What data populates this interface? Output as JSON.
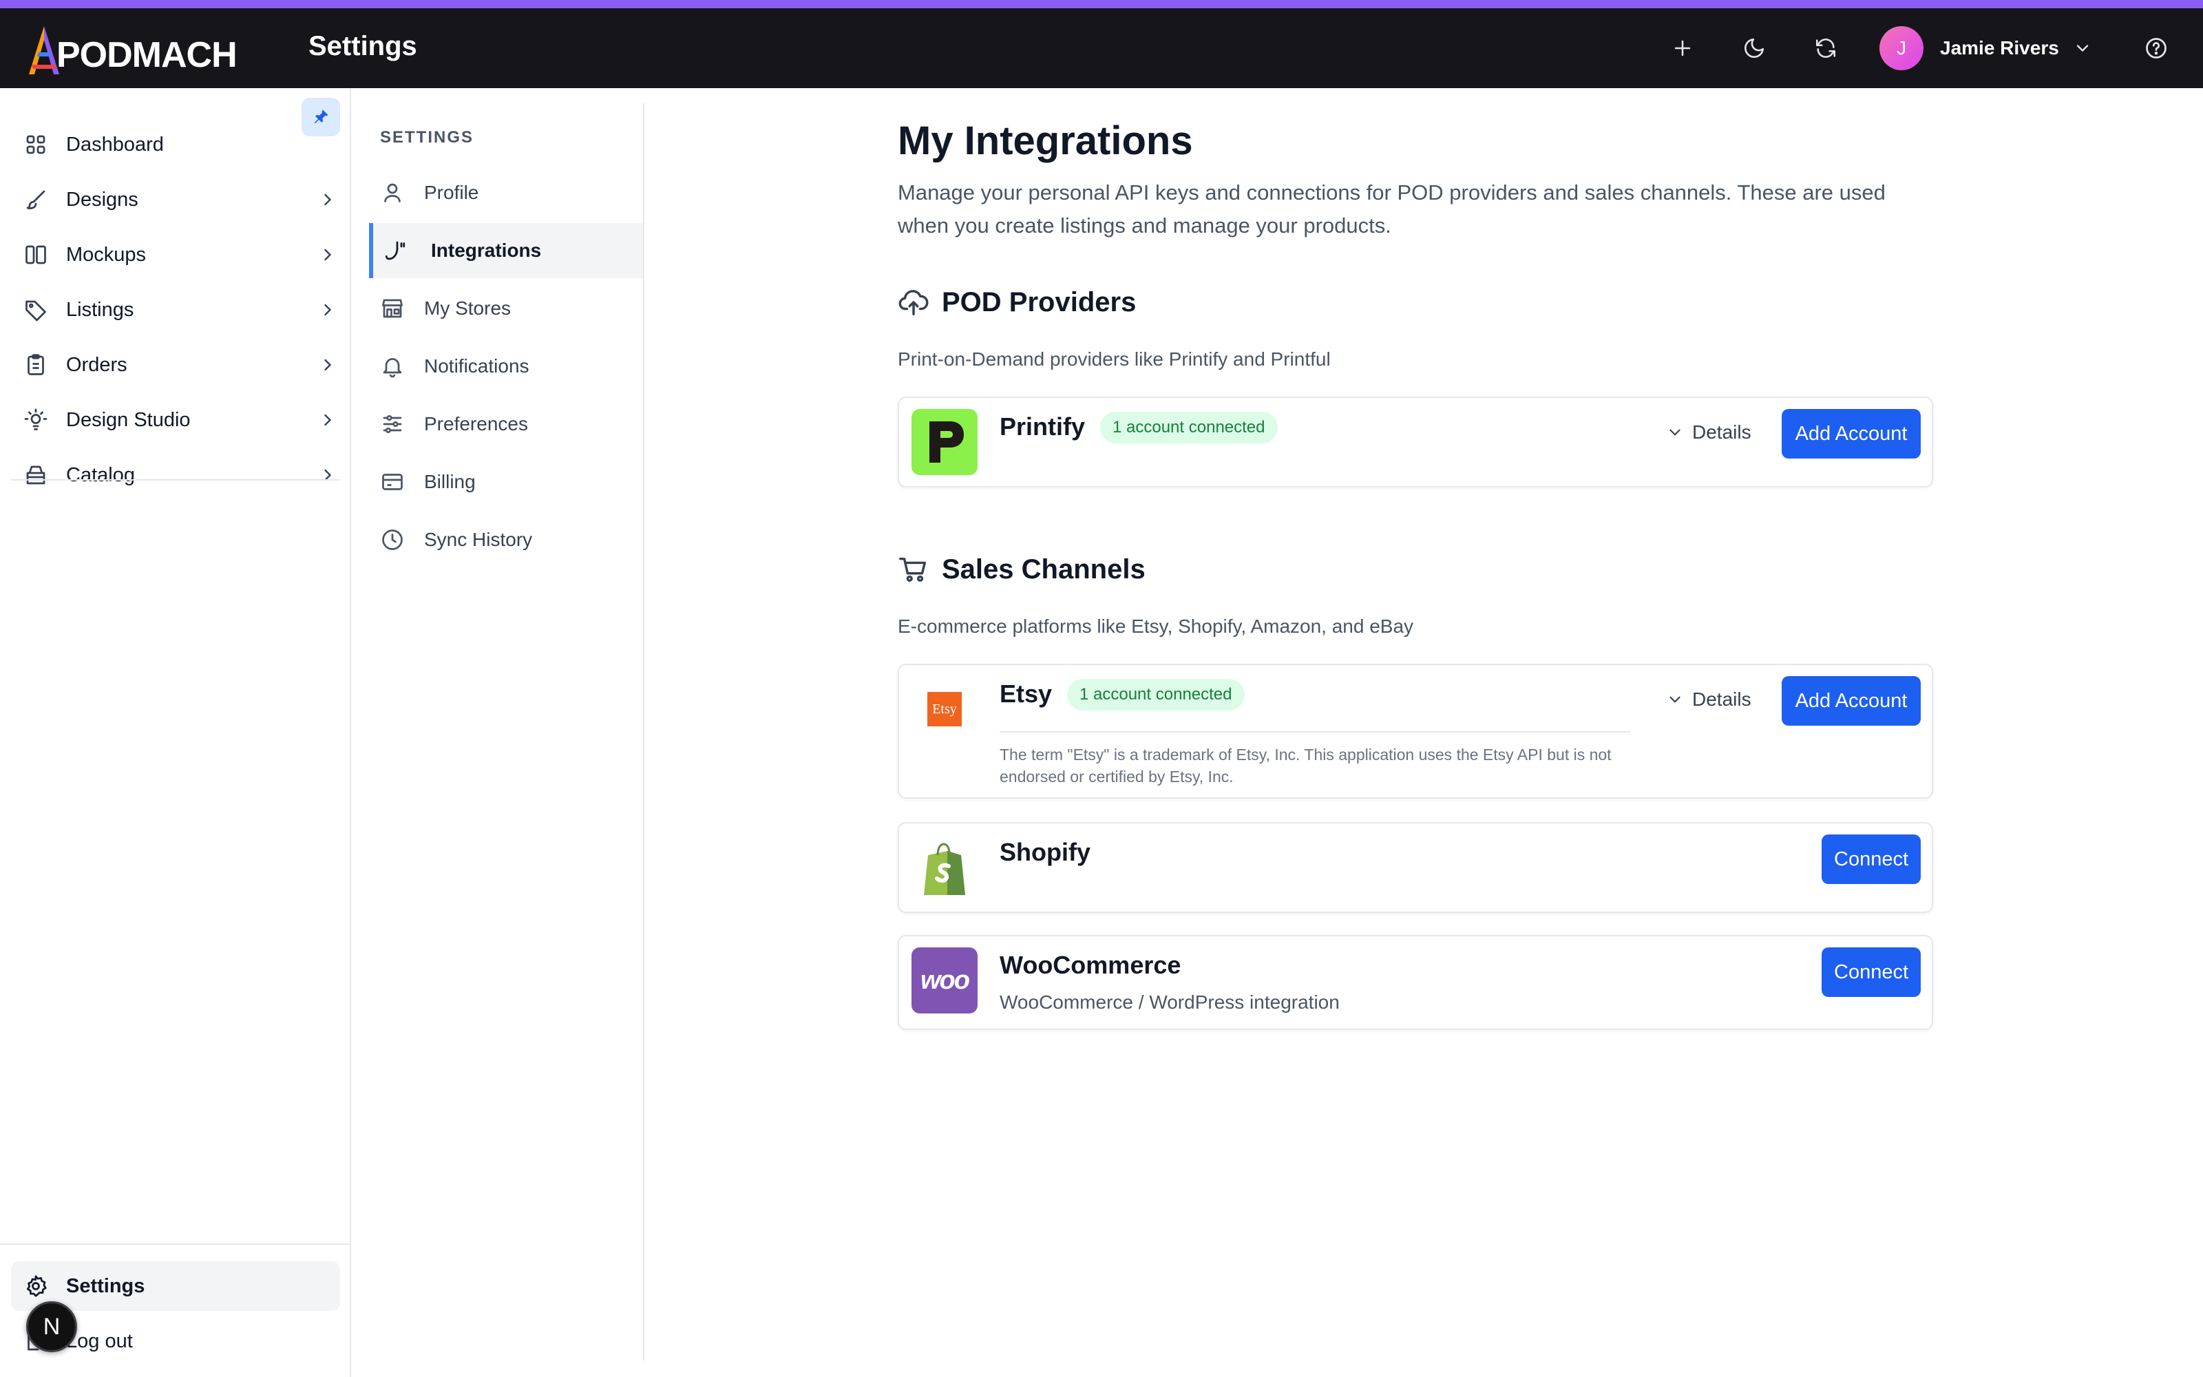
{
  "app": {
    "logo_text": "PODMACH",
    "page_title": "Settings",
    "accent_color": "#8b5cf6",
    "primary_color": "#1d5ff0"
  },
  "topbar": {
    "actions": [
      "plus-icon",
      "moon-icon",
      "refresh-icon"
    ],
    "user": {
      "initial": "J",
      "name": "Jamie Rivers"
    },
    "help_icon": "help-circle-icon"
  },
  "sidebar": {
    "items": [
      {
        "label": "Dashboard",
        "icon": "grid-icon"
      },
      {
        "label": "Designs",
        "icon": "brush-icon"
      },
      {
        "label": "Mockups",
        "icon": "columns-icon"
      },
      {
        "label": "Listings",
        "icon": "tag-icon"
      },
      {
        "label": "Orders",
        "icon": "clipboard-icon"
      },
      {
        "label": "Design Studio",
        "icon": "lightbulb-icon"
      },
      {
        "label": "Catalog",
        "icon": "bag-icon"
      }
    ],
    "bottom": {
      "settings": "Settings",
      "logout": "Log out",
      "fab_initial": "N"
    }
  },
  "subnav": {
    "title": "SETTINGS",
    "items": [
      {
        "label": "Profile",
        "icon": "user-icon"
      },
      {
        "label": "Integrations",
        "icon": "plug-icon"
      },
      {
        "label": "My Stores",
        "icon": "store-icon"
      },
      {
        "label": "Notifications",
        "icon": "bell-icon"
      },
      {
        "label": "Preferences",
        "icon": "sliders-icon"
      },
      {
        "label": "Billing",
        "icon": "credit-card-icon"
      },
      {
        "label": "Sync History",
        "icon": "clock-icon"
      }
    ],
    "active": "Integrations"
  },
  "main": {
    "title": "My Integrations",
    "description": "Manage your personal API keys and connections for POD providers and sales channels. These are used when you create listings and manage your products.",
    "pod_section": {
      "title": "POD Providers",
      "subtitle": "Print-on-Demand providers like Printify and Printful",
      "cards": [
        {
          "name": "Printify",
          "badge": "1 account connected",
          "details": "Details",
          "action": "Add Account",
          "logo_color": "#8cf04a"
        }
      ]
    },
    "sales_section": {
      "title": "Sales Channels",
      "subtitle": "E-commerce platforms like Etsy, Shopify, Amazon, and eBay",
      "etsy": {
        "name": "Etsy",
        "logo_text": "Etsy",
        "badge": "1 account connected",
        "details": "Details",
        "action": "Add Account",
        "disclaimer": "The term \"Etsy\" is a trademark of Etsy, Inc. This application uses the Etsy API but is not endorsed or certified by Etsy, Inc."
      },
      "shopify": {
        "name": "Shopify",
        "action": "Connect"
      },
      "woocommerce": {
        "name": "WooCommerce",
        "logo_text": "woo",
        "subtitle": "WooCommerce / WordPress integration",
        "action": "Connect"
      }
    }
  }
}
